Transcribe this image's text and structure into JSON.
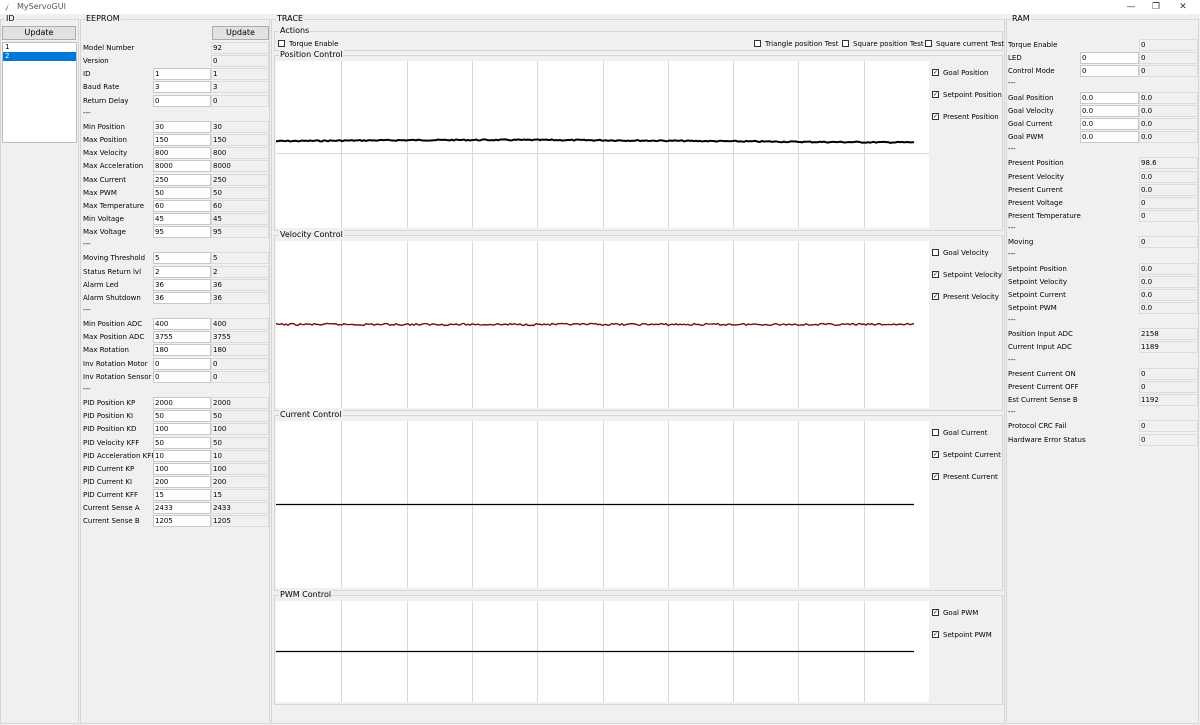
{
  "window": {
    "title": "MyServoGUI",
    "minimize_glyph": "—",
    "maximize_glyph": "❐",
    "close_glyph": "✕"
  },
  "id_panel": {
    "label": "ID",
    "update_label": "Update",
    "items": [
      {
        "text": "1",
        "selected": false
      },
      {
        "text": "2",
        "selected": true
      }
    ]
  },
  "eeprom": {
    "label": "EEPROM",
    "update_label": "Update",
    "rows": [
      {
        "type": "ro",
        "label": "Model Number",
        "value": "92"
      },
      {
        "type": "ro",
        "label": "Version",
        "value": "0"
      },
      {
        "type": "rw",
        "label": "ID",
        "entry": "1",
        "value": "1"
      },
      {
        "type": "rw",
        "label": "Baud Rate",
        "entry": "3",
        "value": "3"
      },
      {
        "type": "rw",
        "label": "Return Delay",
        "entry": "0",
        "value": "0"
      },
      {
        "type": "sep",
        "label": "---"
      },
      {
        "type": "rw",
        "label": "Min Position",
        "entry": "30",
        "value": "30"
      },
      {
        "type": "rw",
        "label": "Max Position",
        "entry": "150",
        "value": "150"
      },
      {
        "type": "rw",
        "label": "Max Velocity",
        "entry": "800",
        "value": "800"
      },
      {
        "type": "rw",
        "label": "Max Acceleration",
        "entry": "8000",
        "value": "8000"
      },
      {
        "type": "rw",
        "label": "Max Current",
        "entry": "250",
        "value": "250"
      },
      {
        "type": "rw",
        "label": "Max PWM",
        "entry": "50",
        "value": "50"
      },
      {
        "type": "rw",
        "label": "Max Temperature",
        "entry": "60",
        "value": "60"
      },
      {
        "type": "rw",
        "label": "Min Voltage",
        "entry": "45",
        "value": "45"
      },
      {
        "type": "rw",
        "label": "Max Voltage",
        "entry": "95",
        "value": "95"
      },
      {
        "type": "sep",
        "label": "---"
      },
      {
        "type": "rw",
        "label": "Moving Threshold",
        "entry": "5",
        "value": "5"
      },
      {
        "type": "rw",
        "label": "Status Return lvl",
        "entry": "2",
        "value": "2"
      },
      {
        "type": "rw",
        "label": "Alarm Led",
        "entry": "36",
        "value": "36"
      },
      {
        "type": "rw",
        "label": "Alarm Shutdown",
        "entry": "36",
        "value": "36"
      },
      {
        "type": "sep",
        "label": "---"
      },
      {
        "type": "rw",
        "label": "Min Position ADC",
        "entry": "400",
        "value": "400"
      },
      {
        "type": "rw",
        "label": "Max Position ADC",
        "entry": "3755",
        "value": "3755"
      },
      {
        "type": "rw",
        "label": "Max Rotation",
        "entry": "180",
        "value": "180"
      },
      {
        "type": "rw",
        "label": "Inv Rotation Motor",
        "entry": "0",
        "value": "0"
      },
      {
        "type": "rw",
        "label": "Inv Rotation Sensor",
        "entry": "0",
        "value": "0"
      },
      {
        "type": "sep",
        "label": "---"
      },
      {
        "type": "rw",
        "label": "PID Position KP",
        "entry": "2000",
        "value": "2000"
      },
      {
        "type": "rw",
        "label": "PID Position KI",
        "entry": "50",
        "value": "50"
      },
      {
        "type": "rw",
        "label": "PID Position KD",
        "entry": "100",
        "value": "100"
      },
      {
        "type": "rw",
        "label": "PID Velocity KFF",
        "entry": "50",
        "value": "50"
      },
      {
        "type": "rw",
        "label": "PID Acceleration KFF",
        "entry": "10",
        "value": "10"
      },
      {
        "type": "rw",
        "label": "PID Current KP",
        "entry": "100",
        "value": "100"
      },
      {
        "type": "rw",
        "label": "PID Current KI",
        "entry": "200",
        "value": "200"
      },
      {
        "type": "rw",
        "label": "PID Current KFF",
        "entry": "15",
        "value": "15"
      },
      {
        "type": "rw",
        "label": "Current Sense A",
        "entry": "2433",
        "value": "2433"
      },
      {
        "type": "rw",
        "label": "Current Sense B",
        "entry": "1205",
        "value": "1205"
      }
    ]
  },
  "trace": {
    "label": "TRACE",
    "actions_label": "Actions",
    "actions": [
      {
        "label": "Torque Enable",
        "checked": false
      },
      {
        "label": "Triangle position Test",
        "checked": false
      },
      {
        "label": "Square position Test",
        "checked": false
      },
      {
        "label": "Square current Test",
        "checked": false
      }
    ],
    "plots": [
      {
        "label": "Position Control",
        "trace_level": 0.52,
        "trace_color": "#000000",
        "noise": 0.6,
        "checks": [
          {
            "label": "Goal Position",
            "checked": true
          },
          {
            "label": "Setpoint Position",
            "checked": true
          },
          {
            "label": "Present Position",
            "checked": true
          }
        ]
      },
      {
        "label": "Velocity Control",
        "trace_level": 0.5,
        "trace_color": "#b00000",
        "noise": 1.0,
        "checks": [
          {
            "label": "Goal Velocity",
            "checked": false
          },
          {
            "label": "Setpoint Velocity",
            "checked": true
          },
          {
            "label": "Present Velocity",
            "checked": true
          }
        ]
      },
      {
        "label": "Current Control",
        "trace_level": 0.5,
        "trace_color": "#000000",
        "noise": 0,
        "checks": [
          {
            "label": "Goal Current",
            "checked": false
          },
          {
            "label": "Setpoint Current",
            "checked": true
          },
          {
            "label": "Present Current",
            "checked": true
          }
        ]
      },
      {
        "label": "PWM Control",
        "trace_level": 0.5,
        "trace_color": "#000000",
        "noise": 0,
        "checks": [
          {
            "label": "Goal PWM",
            "checked": true
          },
          {
            "label": "Setpoint PWM",
            "checked": true
          }
        ]
      }
    ]
  },
  "ram": {
    "label": "RAM",
    "rows": [
      {
        "type": "ro",
        "label": "Torque Enable",
        "value": "0"
      },
      {
        "type": "rw",
        "label": "LED",
        "entry": "0",
        "value": "0"
      },
      {
        "type": "rw",
        "label": "Control Mode",
        "entry": "0",
        "value": "0"
      },
      {
        "type": "sep",
        "label": "---"
      },
      {
        "type": "rw",
        "label": "Goal Position",
        "entry": "0.0",
        "value": "0.0"
      },
      {
        "type": "rw",
        "label": "Goal Velocity",
        "entry": "0.0",
        "value": "0.0"
      },
      {
        "type": "rw",
        "label": "Goal Current",
        "entry": "0.0",
        "value": "0.0"
      },
      {
        "type": "rw",
        "label": "Goal PWM",
        "entry": "0.0",
        "value": "0.0"
      },
      {
        "type": "sep",
        "label": "---"
      },
      {
        "type": "ro",
        "label": "Present Position",
        "value": "98.6"
      },
      {
        "type": "ro",
        "label": "Present Velocity",
        "value": "0.0"
      },
      {
        "type": "ro",
        "label": "Present Current",
        "value": "0.0"
      },
      {
        "type": "ro",
        "label": "Present Voltage",
        "value": "0"
      },
      {
        "type": "ro",
        "label": "Present Temperature",
        "value": "0"
      },
      {
        "type": "sep",
        "label": "---"
      },
      {
        "type": "ro",
        "label": "Moving",
        "value": "0"
      },
      {
        "type": "sep",
        "label": "---"
      },
      {
        "type": "ro",
        "label": "Setpoint Position",
        "value": "0.0"
      },
      {
        "type": "ro",
        "label": "Setpoint Velocity",
        "value": "0.0"
      },
      {
        "type": "ro",
        "label": "Setpoint Current",
        "value": "0.0"
      },
      {
        "type": "ro",
        "label": "Setpoint PWM",
        "value": "0.0"
      },
      {
        "type": "sep",
        "label": "---"
      },
      {
        "type": "ro",
        "label": "Position Input ADC",
        "value": "2158"
      },
      {
        "type": "ro",
        "label": "Current Input ADC",
        "value": "1189"
      },
      {
        "type": "sep",
        "label": "---"
      },
      {
        "type": "ro",
        "label": "Present Current ON",
        "value": "0"
      },
      {
        "type": "ro",
        "label": "Present Current OFF",
        "value": "0"
      },
      {
        "type": "ro",
        "label": "Est Current Sense B",
        "value": "1192"
      },
      {
        "type": "sep",
        "label": "---"
      },
      {
        "type": "ro",
        "label": "Protocol CRC Fail",
        "value": "0"
      },
      {
        "type": "ro",
        "label": "Hardware Error Status",
        "value": "0"
      }
    ]
  }
}
